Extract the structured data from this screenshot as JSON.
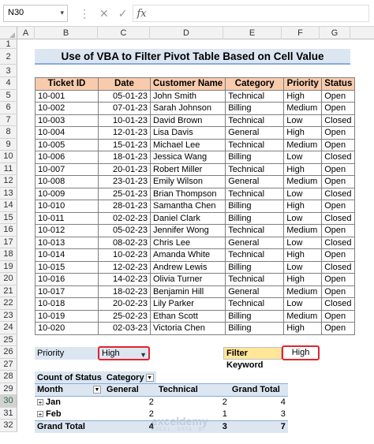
{
  "namebox": "N30",
  "formula": "",
  "columns": [
    "A",
    "B",
    "C",
    "D",
    "E",
    "F",
    "G"
  ],
  "rows": [
    "1",
    "2",
    "3",
    "4",
    "5",
    "6",
    "7",
    "8",
    "9",
    "10",
    "11",
    "12",
    "13",
    "14",
    "15",
    "16",
    "17",
    "18",
    "19",
    "20",
    "21",
    "22",
    "23",
    "24",
    "25",
    "26",
    "27",
    "28",
    "29",
    "30",
    "31",
    "32"
  ],
  "title": "Use of VBA to Filter Pivot Table Based on Cell Value",
  "table": {
    "headers": [
      "Ticket ID",
      "Date",
      "Customer Name",
      "Category",
      "Priority",
      "Status"
    ],
    "rows": [
      [
        "10-001",
        "05-01-23",
        "John Smith",
        "Technical",
        "High",
        "Open"
      ],
      [
        "10-002",
        "07-01-23",
        "Sarah Johnson",
        "Billing",
        "Medium",
        "Open"
      ],
      [
        "10-003",
        "10-01-23",
        "David Brown",
        "Technical",
        "Low",
        "Closed"
      ],
      [
        "10-004",
        "12-01-23",
        "Lisa Davis",
        "General",
        "High",
        "Open"
      ],
      [
        "10-005",
        "15-01-23",
        "Michael Lee",
        "Technical",
        "Medium",
        "Open"
      ],
      [
        "10-006",
        "18-01-23",
        "Jessica Wang",
        "Billing",
        "Low",
        "Closed"
      ],
      [
        "10-007",
        "20-01-23",
        "Robert Miller",
        "Technical",
        "High",
        "Open"
      ],
      [
        "10-008",
        "23-01-23",
        "Emily Wilson",
        "General",
        "Medium",
        "Open"
      ],
      [
        "10-009",
        "25-01-23",
        "Brian Thompson",
        "Technical",
        "Low",
        "Closed"
      ],
      [
        "10-010",
        "28-01-23",
        "Samantha Chen",
        "Billing",
        "High",
        "Open"
      ],
      [
        "10-011",
        "02-02-23",
        "Daniel Clark",
        "Billing",
        "Low",
        "Closed"
      ],
      [
        "10-012",
        "05-02-23",
        "Jennifer Wong",
        "Technical",
        "Medium",
        "Open"
      ],
      [
        "10-013",
        "08-02-23",
        "Chris Lee",
        "General",
        "Low",
        "Closed"
      ],
      [
        "10-014",
        "10-02-23",
        "Amanda White",
        "Technical",
        "High",
        "Open"
      ],
      [
        "10-015",
        "12-02-23",
        "Andrew Lewis",
        "Billing",
        "Low",
        "Closed"
      ],
      [
        "10-016",
        "14-02-23",
        "Olivia Turner",
        "Technical",
        "High",
        "Open"
      ],
      [
        "10-017",
        "18-02-23",
        "Benjamin Hill",
        "General",
        "Medium",
        "Open"
      ],
      [
        "10-018",
        "20-02-23",
        "Lily Parker",
        "Technical",
        "Low",
        "Closed"
      ],
      [
        "10-019",
        "25-02-23",
        "Ethan Scott",
        "Billing",
        "Medium",
        "Open"
      ],
      [
        "10-020",
        "02-03-23",
        "Victoria Chen",
        "Billing",
        "High",
        "Open"
      ]
    ]
  },
  "priority_label": "Priority",
  "priority_value": "High",
  "filter_keyword_label": "Filter Keyword",
  "filter_keyword_value": "High",
  "pivot": {
    "values_label": "Count of Status",
    "column_field": "Category",
    "row_field": "Month",
    "col_headers": [
      "General",
      "Technical",
      "Grand Total"
    ],
    "rows": [
      {
        "label": "Jan",
        "values": [
          "2",
          "2",
          "4"
        ]
      },
      {
        "label": "Feb",
        "values": [
          "2",
          "1",
          "3"
        ]
      }
    ],
    "grand_total_label": "Grand Total",
    "grand_total_values": [
      "4",
      "3",
      "7"
    ]
  },
  "watermark": "exceldemy",
  "watermark_sub": "EXCEL · DATA · BI"
}
